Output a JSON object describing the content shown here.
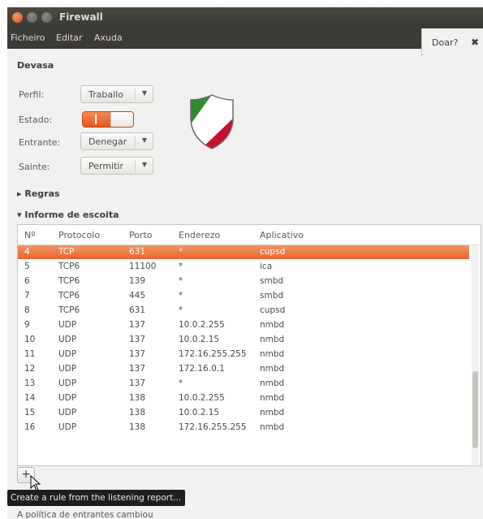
{
  "window": {
    "title": "Firewall"
  },
  "menu": [
    "Ficheiro",
    "Editar",
    "Axuda"
  ],
  "donate": {
    "label": "Doar?",
    "close": "✖"
  },
  "firewall": {
    "section": "Devasa",
    "profile_label": "Perfil:",
    "profile_value": "Traballo",
    "status_label": "Estado:",
    "status_on": true,
    "incoming_label": "Entrante:",
    "incoming_value": "Denegar",
    "outgoing_label": "Sainte:",
    "outgoing_value": "Permitir",
    "shield_icon": "firewall-shield-icon",
    "shield_colors": [
      "#2e8b2e",
      "#ffffff",
      "#c8102e"
    ]
  },
  "rules_expander": "▸ Regras",
  "report_expander": "▾ Informe de escoita",
  "report": {
    "columns": [
      "Nº",
      "Protocolo",
      "Porto",
      "Enderezo",
      "Aplicativo"
    ],
    "rows": [
      {
        "n": "4",
        "proto": "TCP",
        "port": "631",
        "addr": "*",
        "app": "cupsd",
        "selected": true
      },
      {
        "n": "5",
        "proto": "TCP6",
        "port": "11100",
        "addr": "*",
        "app": "ica"
      },
      {
        "n": "6",
        "proto": "TCP6",
        "port": "139",
        "addr": "*",
        "app": "smbd"
      },
      {
        "n": "7",
        "proto": "TCP6",
        "port": "445",
        "addr": "*",
        "app": "smbd"
      },
      {
        "n": "8",
        "proto": "TCP6",
        "port": "631",
        "addr": "*",
        "app": "cupsd"
      },
      {
        "n": "9",
        "proto": "UDP",
        "port": "137",
        "addr": "10.0.2.255",
        "app": "nmbd"
      },
      {
        "n": "10",
        "proto": "UDP",
        "port": "137",
        "addr": "10.0.2.15",
        "app": "nmbd"
      },
      {
        "n": "11",
        "proto": "UDP",
        "port": "137",
        "addr": "172.16.255.255",
        "app": "nmbd"
      },
      {
        "n": "12",
        "proto": "UDP",
        "port": "137",
        "addr": "172.16.0.1",
        "app": "nmbd"
      },
      {
        "n": "13",
        "proto": "UDP",
        "port": "137",
        "addr": "*",
        "app": "nmbd"
      },
      {
        "n": "14",
        "proto": "UDP",
        "port": "138",
        "addr": "10.0.2.255",
        "app": "nmbd"
      },
      {
        "n": "15",
        "proto": "UDP",
        "port": "138",
        "addr": "10.0.2.15",
        "app": "nmbd"
      },
      {
        "n": "16",
        "proto": "UDP",
        "port": "138",
        "addr": "172.16.255.255",
        "app": "nmbd"
      }
    ]
  },
  "add_button": "+",
  "tooltip": "Create a rule from the listening report...",
  "status_message": "A política de entrantes cambiou",
  "colors": {
    "accent": "#e8652a",
    "titlebar": "#3c3b37"
  }
}
